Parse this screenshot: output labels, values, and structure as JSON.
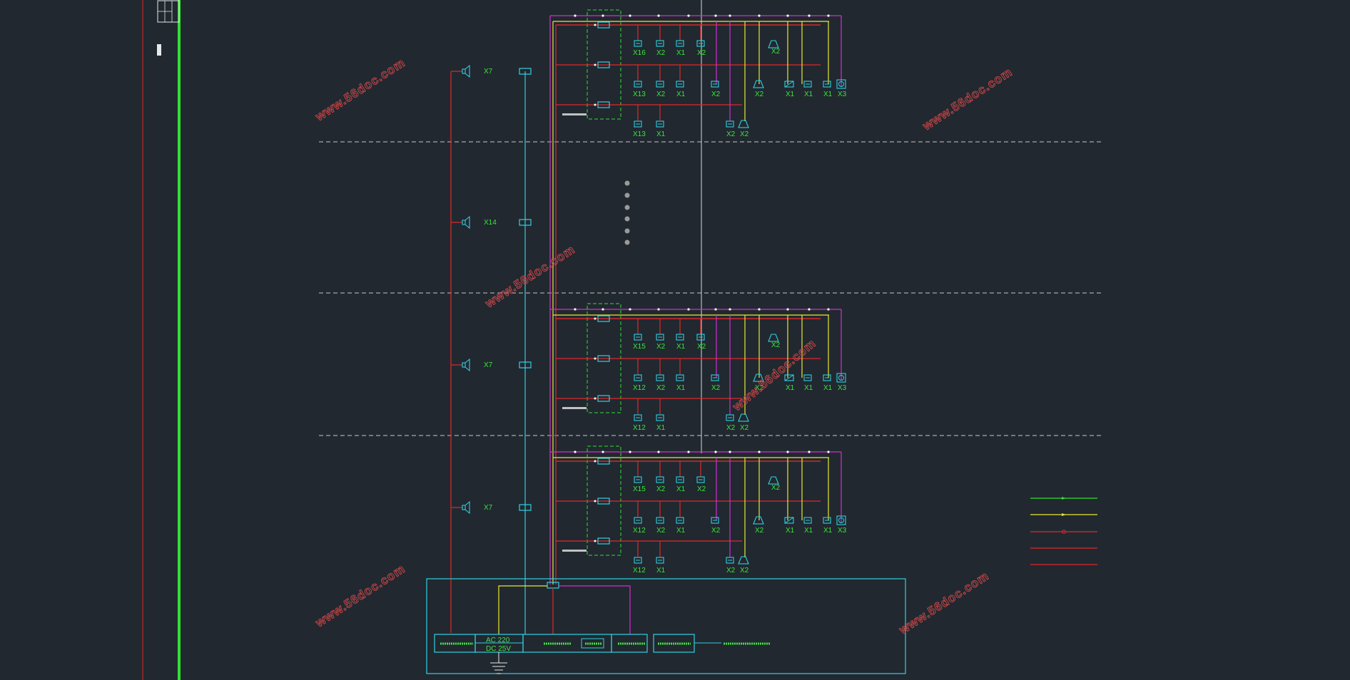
{
  "colors": {
    "background": "#212830",
    "red": "#e02828",
    "cyan": "#30d0e0",
    "yellow": "#e8e830",
    "magenta": "#d030d0",
    "green": "#30e030",
    "grey": "#b8b8b8",
    "watermark": "#d04848"
  },
  "watermark": "www.56doc.com",
  "speakers": [
    {
      "label": "X7"
    },
    {
      "label": "X14"
    },
    {
      "label": "X7"
    },
    {
      "label": "X7"
    }
  ],
  "floors": [
    {
      "row1": [
        "X16",
        "X2",
        "X1",
        "X2",
        "X2"
      ],
      "row2": [
        "X13",
        "X2",
        "X1",
        "X2",
        "X2",
        "X1",
        "X1",
        "X1",
        "X3"
      ],
      "row3": [
        "X13",
        "X1",
        "X2",
        "X2"
      ]
    },
    {
      "row1": [
        "X15",
        "X2",
        "X1",
        "X2",
        "X2"
      ],
      "row2": [
        "X12",
        "X2",
        "X1",
        "X2",
        "X2",
        "X1",
        "X1",
        "X1",
        "X3"
      ],
      "row3": [
        "X12",
        "X1",
        "X2",
        "X2"
      ]
    },
    {
      "row1": [
        "X15",
        "X2",
        "X1",
        "X2",
        "X2"
      ],
      "row2": [
        "X12",
        "X2",
        "X1",
        "X2",
        "X2",
        "X1",
        "X1",
        "X1",
        "X3"
      ],
      "row3": [
        "X12",
        "X1",
        "X2",
        "X2"
      ]
    }
  ],
  "power": {
    "line1": "AC 220",
    "line2": "DC 25V"
  },
  "legend": {
    "lines": [
      {
        "color": "#30e030",
        "style": "arrow"
      },
      {
        "color": "#e8e830",
        "style": "arrow"
      },
      {
        "color": "#e02828",
        "style": "circle"
      },
      {
        "color": "#e02828",
        "style": "plain"
      },
      {
        "color": "#e02828",
        "style": "plain"
      }
    ]
  }
}
